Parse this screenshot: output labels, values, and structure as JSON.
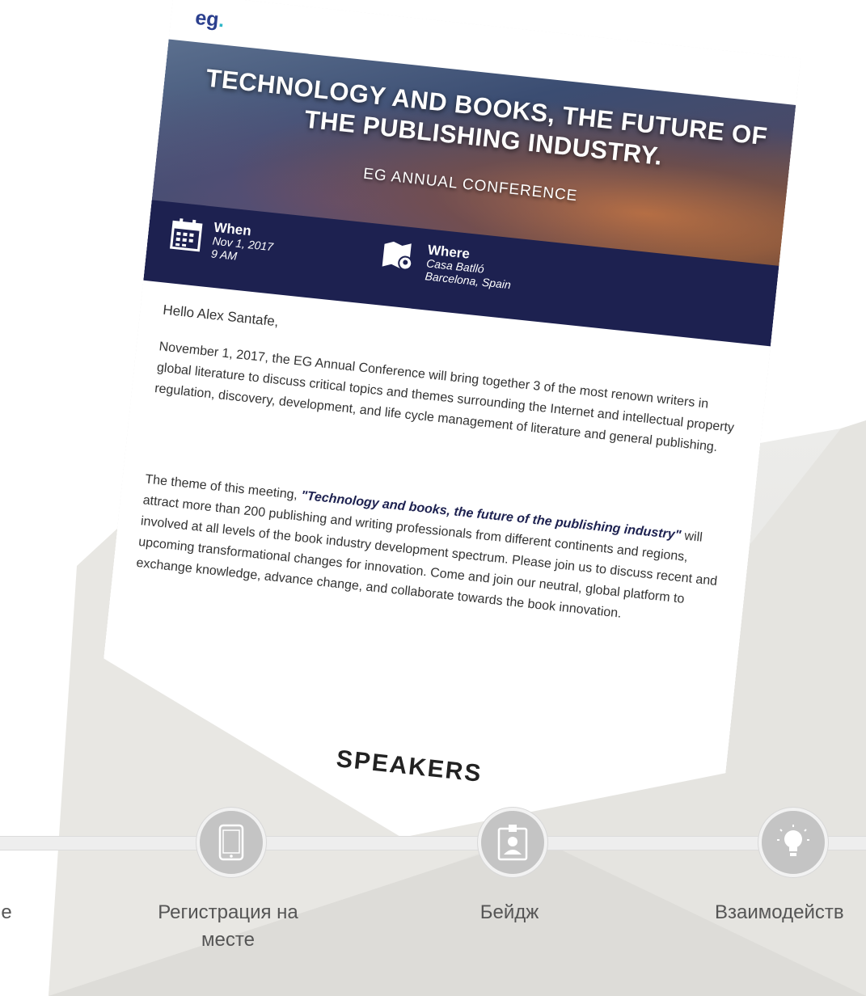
{
  "email": {
    "logo_text": "eg",
    "logo_dot": ".",
    "hero_title": "TECHNOLOGY AND BOOKS, THE FUTURE OF THE PUBLISHING INDUSTRY.",
    "hero_subtitle": "EG ANNUAL CONFERENCE",
    "when": {
      "label": "When",
      "date": "Nov 1, 2017",
      "time": "9 AM",
      "icon": "calendar-icon"
    },
    "where": {
      "label": "Where",
      "place": "Casa Batlló",
      "city": "Barcelona, Spain",
      "icon": "map-pin-icon"
    },
    "greeting": "Hello Alex Santafe,",
    "paragraph1": "November 1, 2017, the EG Annual Conference will bring together 3 of the most renown writers in global literature to discuss critical topics and themes surrounding the Internet and intellectual property regulation, discovery, development, and life cycle management of literature and general publishing.",
    "paragraph2_start": "The theme of this meeting, ",
    "paragraph2_emphasis": "\"Technology and books, the future of the publishing industry\"",
    "paragraph2_end": " will attract more than 200 publishing and writing professionals from different continents and regions, involved at all levels of the book industry development spectrum. Please join us to discuss recent and upcoming transformational changes for innovation. Come and join our neutral, global platform to exchange knowledge, advance change, and collaborate towards the book innovation.",
    "section_heading": "SPEAKERS"
  },
  "timeline": {
    "steps": [
      {
        "label": "е",
        "icon": "none"
      },
      {
        "label": "Регистрация на месте",
        "icon": "smartphone-icon"
      },
      {
        "label": "Бейдж",
        "icon": "badge-icon"
      },
      {
        "label": "Взаимодейств",
        "icon": "lightbulb-icon"
      }
    ]
  },
  "colors": {
    "brand_navy": "#1d2150",
    "logo_blue": "#2b3f8e",
    "logo_dot": "#2fb7c8",
    "step_circle": "#c4c4c4",
    "label_gray": "#555555"
  }
}
